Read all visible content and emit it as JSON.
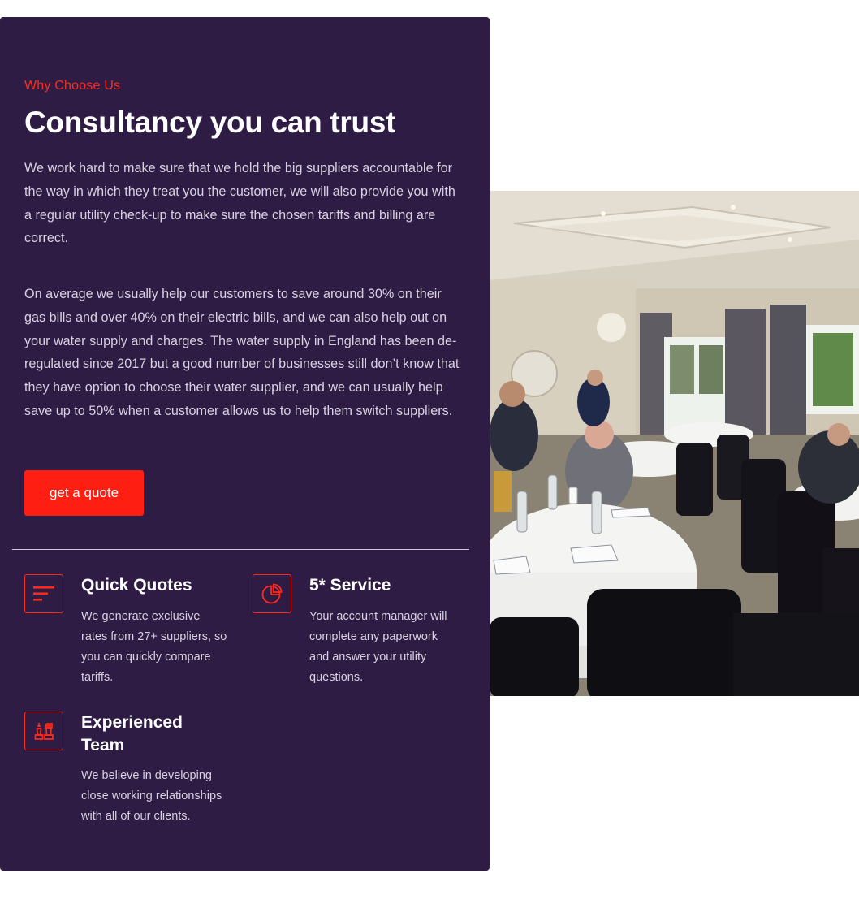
{
  "section": {
    "eyebrow": "Why Choose Us",
    "title": "Consultancy you can trust",
    "paragraph_1": "We work hard to make sure that we hold the big suppliers accountable for the way in which they treat you the customer, we will also provide you with a regular utility check-up to make sure the chosen tariffs and billing are correct.",
    "paragraph_2": "On average we usually help our customers to save around 30% on their gas bills and over 40% on their electric bills, and we can also help out on your water supply and charges. The water supply in England has been de-regulated since 2017 but a good number of businesses still don’t know that they have option to choose their water supplier, and we can usually help save up to 50% when a customer allows us to help them switch suppliers.",
    "cta_label": "get a quote"
  },
  "features": [
    {
      "icon": "bars-icon",
      "title": "Quick Quotes",
      "text": "We generate exclusive rates from 27+ suppliers, so you can quickly compare tariffs."
    },
    {
      "icon": "pie-chart-icon",
      "title": "5* Service",
      "text": "Your account manager will complete any paperwork and answer your utility questions."
    },
    {
      "icon": "chess-pieces-icon",
      "title": "Experienced Team",
      "text": "We believe in developing close working relationships with all of our clients."
    }
  ],
  "colors": {
    "panel_bg": "#2f1c45",
    "accent": "#ff2a1a",
    "heading": "#ffffff",
    "body_text": "#d8d0e0"
  }
}
